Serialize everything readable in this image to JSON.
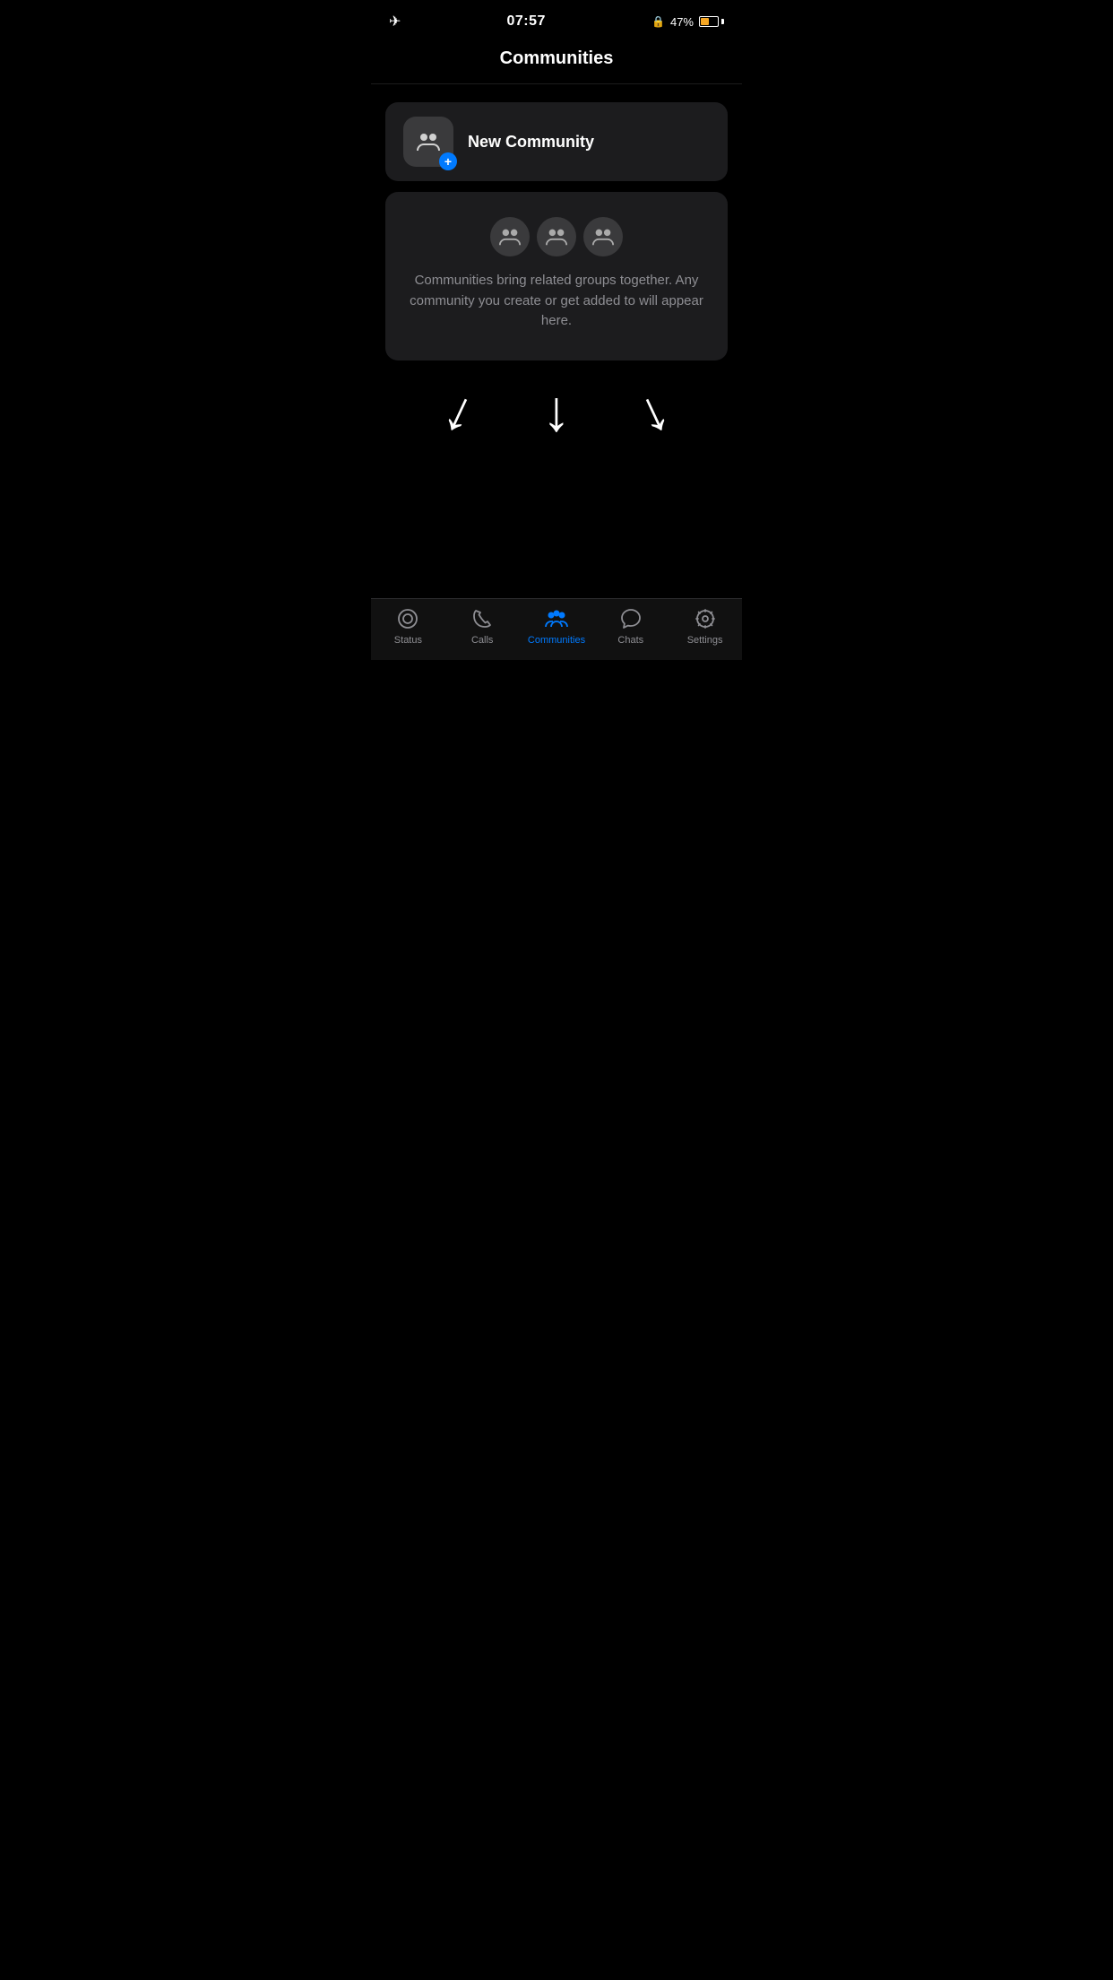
{
  "statusBar": {
    "time": "07:57",
    "lockIcon": "🔒",
    "battery": "47%",
    "airplaneMode": true
  },
  "header": {
    "title": "Communities"
  },
  "newCommunity": {
    "label": "New Community"
  },
  "infoCard": {
    "description": "Communities bring related groups together. Any community you create or get added to will appear here."
  },
  "bottomNav": {
    "items": [
      {
        "id": "status",
        "label": "Status",
        "active": false
      },
      {
        "id": "calls",
        "label": "Calls",
        "active": false
      },
      {
        "id": "communities",
        "label": "Communities",
        "active": true
      },
      {
        "id": "chats",
        "label": "Chats",
        "active": false
      },
      {
        "id": "settings",
        "label": "Settings",
        "active": false
      }
    ]
  },
  "arrows": {
    "count": 3,
    "color": "#ffffff"
  }
}
